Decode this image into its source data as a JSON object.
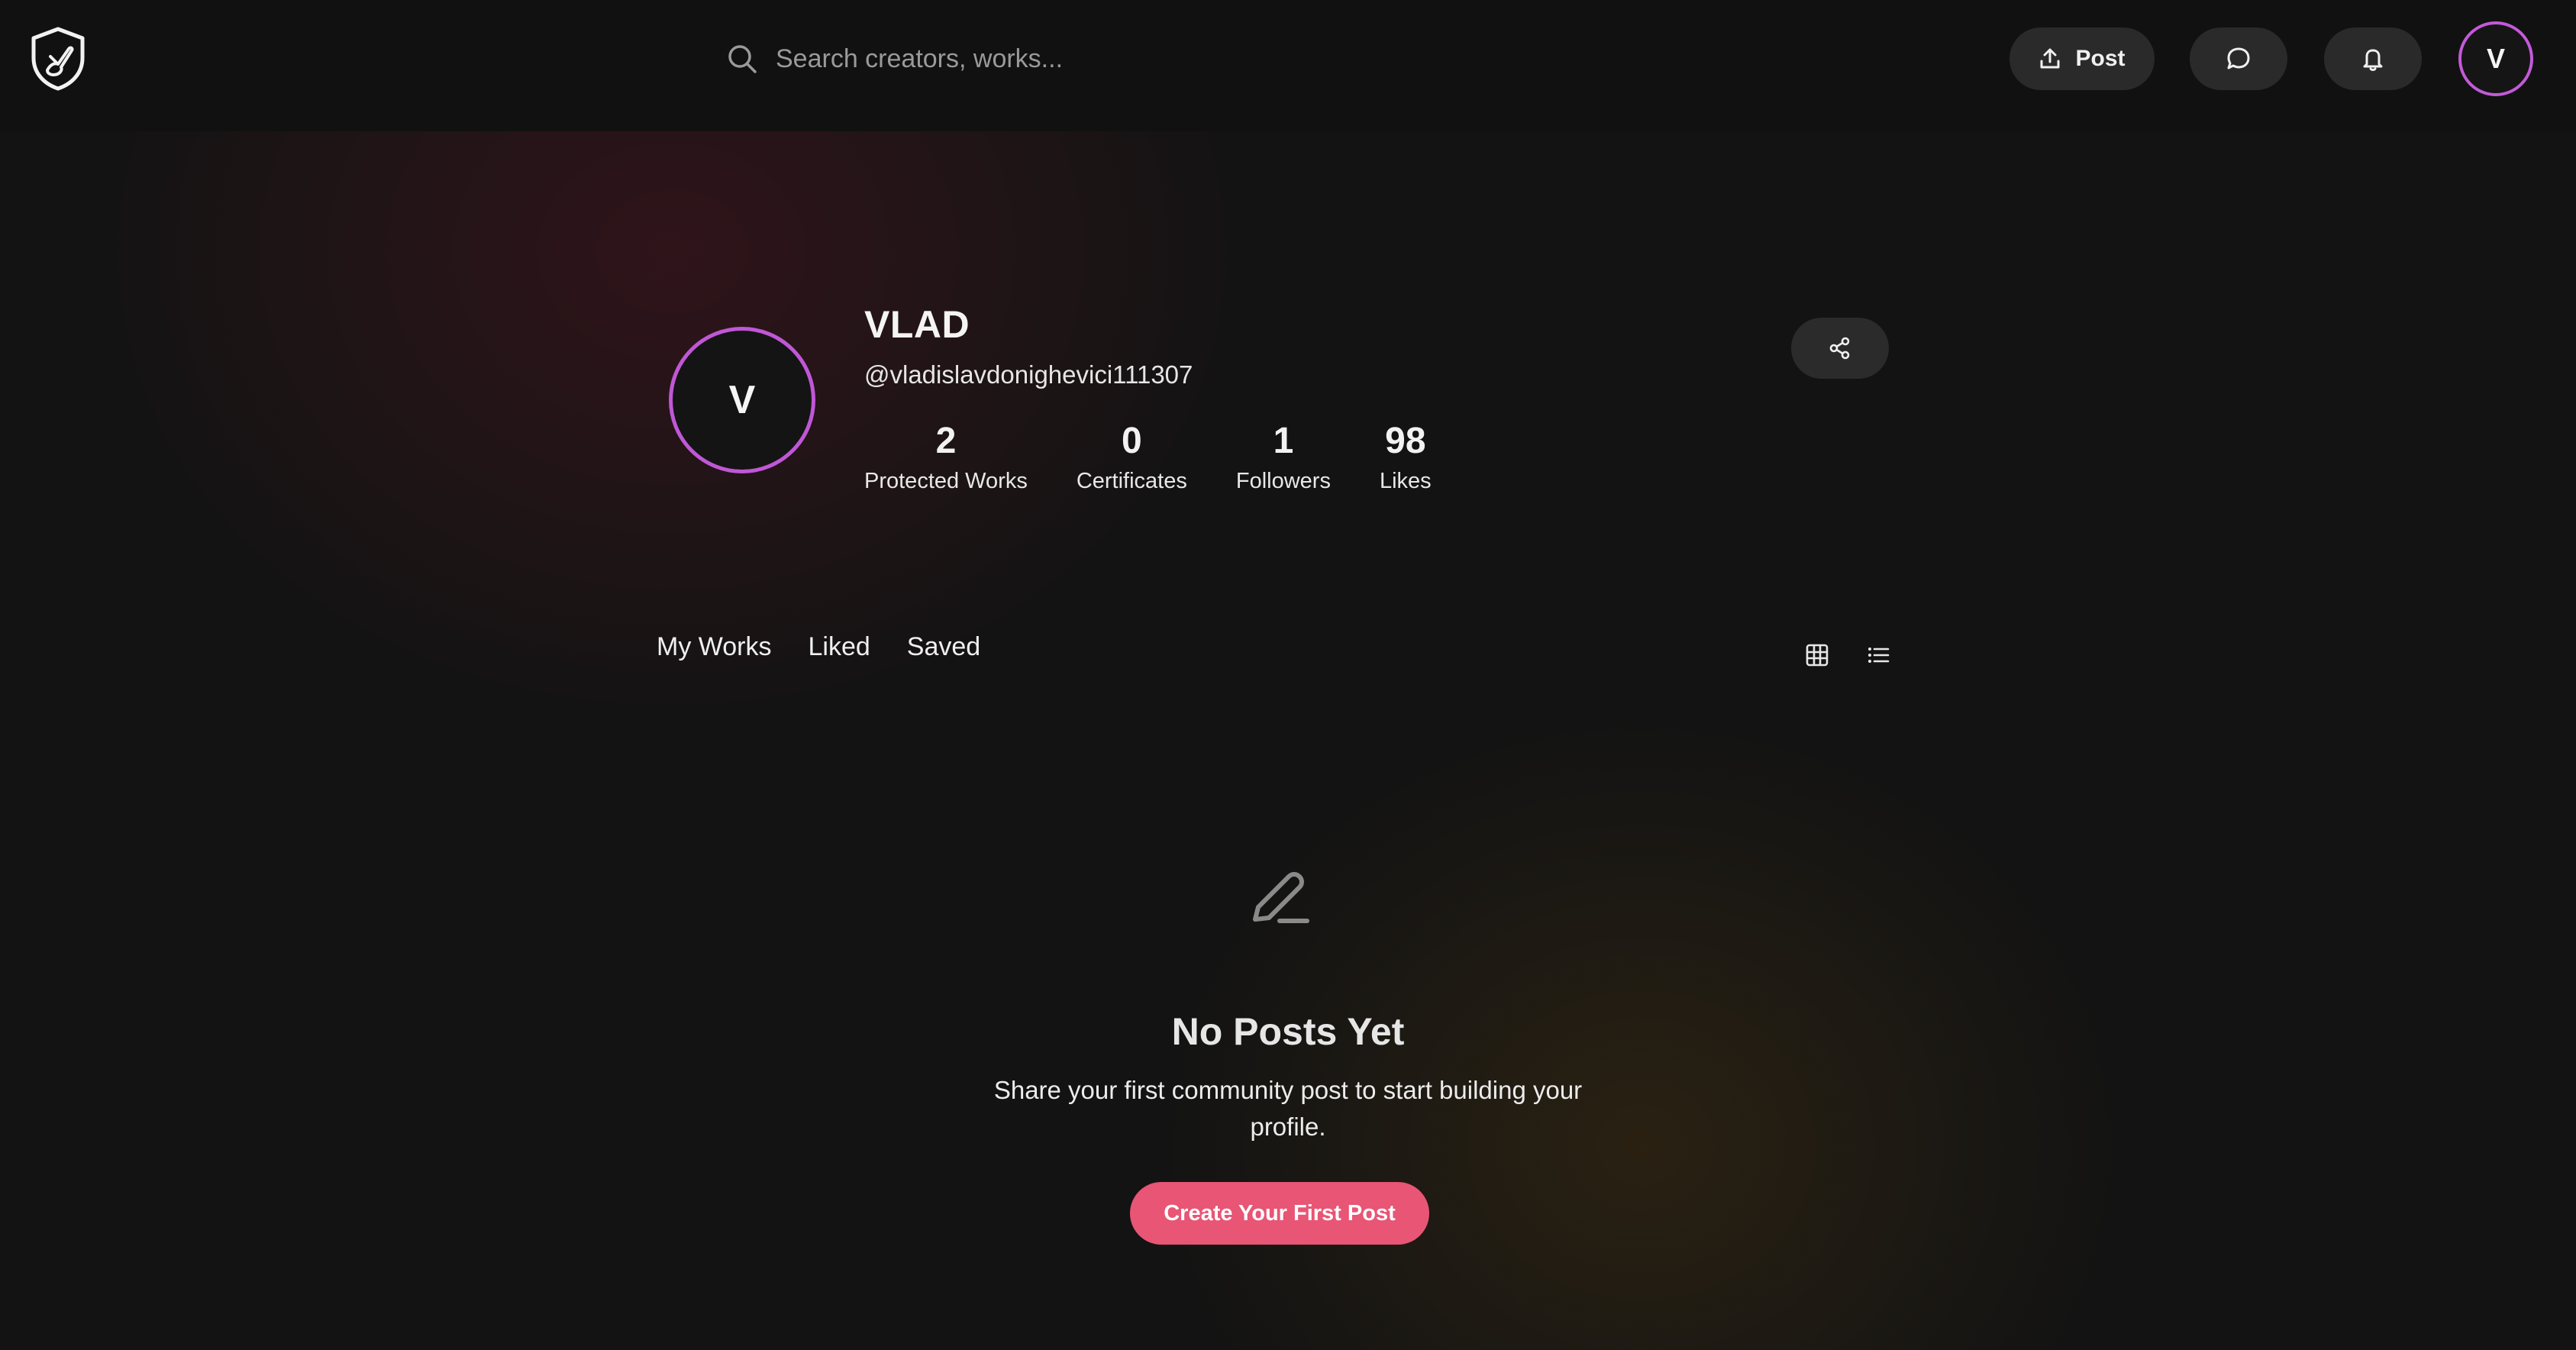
{
  "header": {
    "search": {
      "placeholder": "Search creators, works..."
    },
    "post_label": "Post",
    "avatar_initial": "V"
  },
  "profile": {
    "avatar_initial": "V",
    "name": "VLAD",
    "handle": "@vladislavdonighevici111307",
    "stats": [
      {
        "value": "2",
        "label": "Protected Works"
      },
      {
        "value": "0",
        "label": "Certificates"
      },
      {
        "value": "1",
        "label": "Followers"
      },
      {
        "value": "98",
        "label": "Likes"
      }
    ]
  },
  "tabs": [
    {
      "label": "My Works"
    },
    {
      "label": "Liked"
    },
    {
      "label": "Saved"
    }
  ],
  "empty_state": {
    "title": "No Posts Yet",
    "description": "Share your first community post to start building your profile.",
    "cta_label": "Create Your First Post"
  },
  "colors": {
    "accent": "#e85575",
    "avatar_ring": "#c057d6",
    "background": "#131313"
  }
}
